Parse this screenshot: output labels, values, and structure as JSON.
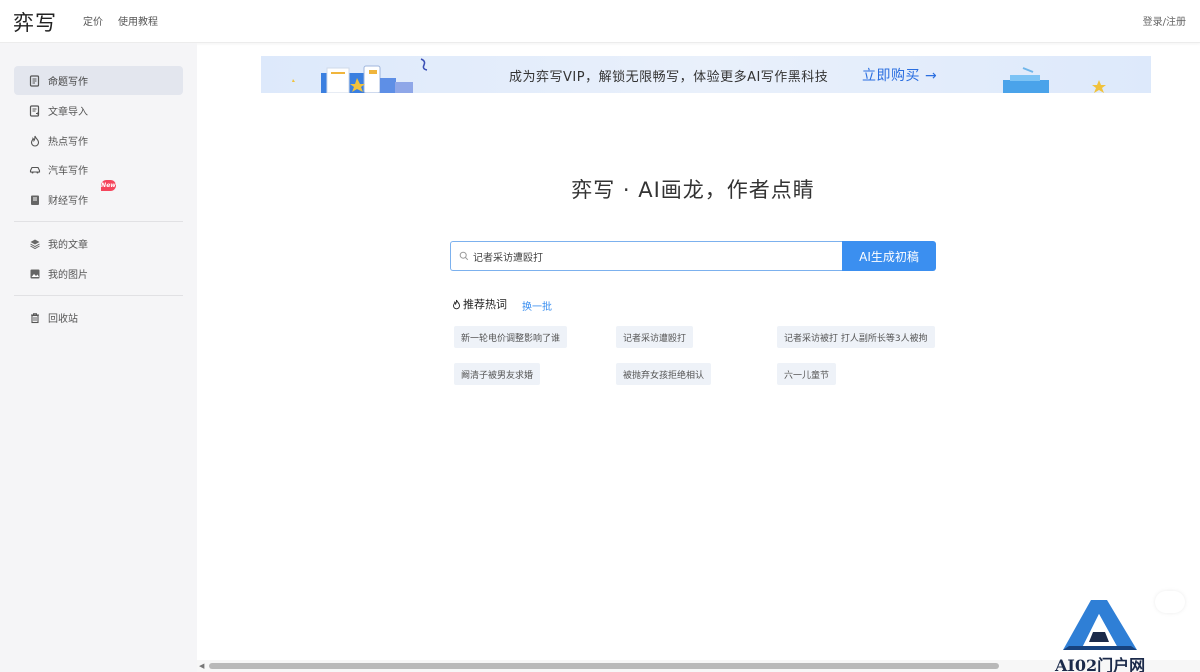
{
  "header": {
    "logo": "弈写",
    "nav": [
      "定价",
      "使用教程"
    ],
    "login": "登录/注册"
  },
  "sidebar": {
    "items": [
      {
        "label": "命题写作",
        "icon": "document-edit-icon",
        "active": true
      },
      {
        "label": "文章导入",
        "icon": "import-document-icon"
      },
      {
        "label": "热点写作",
        "icon": "flame-icon"
      },
      {
        "label": "汽车写作",
        "icon": "car-icon"
      },
      {
        "label": "财经写作",
        "icon": "finance-book-icon",
        "badge": "New"
      },
      {
        "label": "我的文章",
        "icon": "layers-icon"
      },
      {
        "label": "我的图片",
        "icon": "image-icon"
      },
      {
        "label": "回收站",
        "icon": "trash-icon"
      }
    ]
  },
  "banner": {
    "text": "成为弈写VIP，解锁无限畅写，体验更多AI写作黑科技",
    "cta": "立即购买 →"
  },
  "main": {
    "headline": "弈写 · AI画龙，作者点睛",
    "search": {
      "value": "记者采访遭殴打",
      "button": "AI生成初稿"
    },
    "hot": {
      "title": "推荐热词",
      "refresh": "换一批",
      "tags": [
        "新一轮电价调整影响了谁",
        "记者采访遭殴打",
        "记者采访被打 打人副所长等3人被拘",
        "阚清子被男友求婚",
        "被抛弃女孩拒绝相认",
        "六一儿童节"
      ]
    }
  },
  "watermark": {
    "text": "AI02门户网"
  },
  "colors": {
    "accent": "#3b8ff0",
    "sidebar_bg": "#f5f5f7",
    "banner_bg": "#dde9fb",
    "tag_bg": "#eef2f8"
  }
}
